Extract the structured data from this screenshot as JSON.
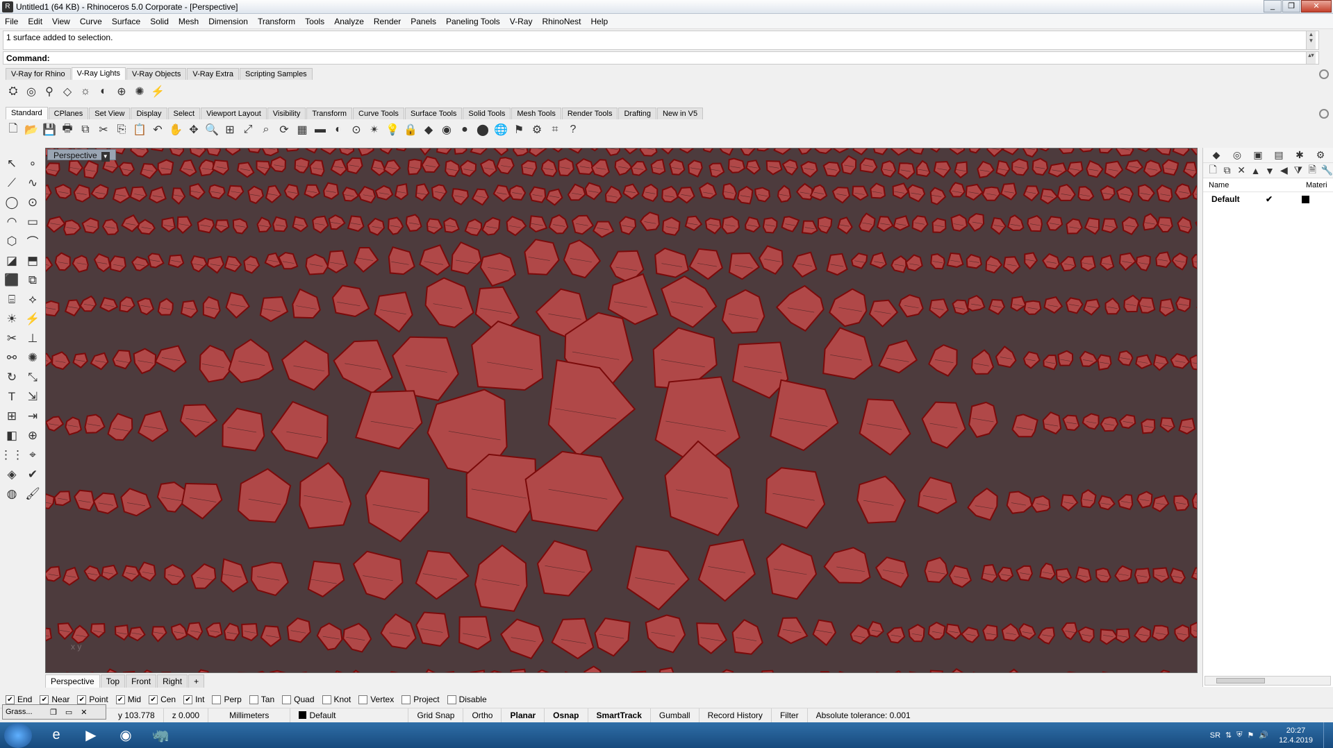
{
  "window": {
    "title": "Untitled1 (64 KB) - Rhinoceros  5.0 Corporate - [Perspective]"
  },
  "menu": [
    "File",
    "Edit",
    "View",
    "Curve",
    "Surface",
    "Solid",
    "Mesh",
    "Dimension",
    "Transform",
    "Tools",
    "Analyze",
    "Render",
    "Panels",
    "Paneling Tools",
    "V-Ray",
    "RhinoNest",
    "Help"
  ],
  "command_history": "1 surface added to selection.",
  "command_prompt": "Command:",
  "vray_tabs": [
    "V-Ray for Rhino",
    "V-Ray Lights",
    "V-Ray Objects",
    "V-Ray Extra",
    "Scripting Samples"
  ],
  "vray_active_tab": "V-Ray Lights",
  "vray_icons": [
    "spot-light-icon",
    "sphere-light-icon",
    "ies-light-icon",
    "rect-light-icon",
    "omni-light-icon",
    "dome-light-icon",
    "sun-icon",
    "sky-light-icon",
    "mesh-light-icon"
  ],
  "main_tabs": [
    "Standard",
    "CPlanes",
    "Set View",
    "Display",
    "Select",
    "Viewport Layout",
    "Visibility",
    "Transform",
    "Curve Tools",
    "Surface Tools",
    "Solid Tools",
    "Mesh Tools",
    "Render Tools",
    "Drafting",
    "New in V5"
  ],
  "main_active_tab": "Standard",
  "standard_icons": [
    {
      "name": "new-icon",
      "glyph": "🗋"
    },
    {
      "name": "open-icon",
      "glyph": "📂"
    },
    {
      "name": "save-icon",
      "glyph": "💾"
    },
    {
      "name": "print-icon",
      "glyph": "🖶"
    },
    {
      "name": "export-icon",
      "glyph": "⧉"
    },
    {
      "name": "cut-icon",
      "glyph": "✂"
    },
    {
      "name": "copy-icon",
      "glyph": "⎘"
    },
    {
      "name": "paste-icon",
      "glyph": "📋"
    },
    {
      "name": "undo-icon",
      "glyph": "↶"
    },
    {
      "name": "pan-icon",
      "glyph": "✋"
    },
    {
      "name": "move-view-icon",
      "glyph": "✥"
    },
    {
      "name": "zoom-icon",
      "glyph": "🔍"
    },
    {
      "name": "zoom-window-icon",
      "glyph": "⊞"
    },
    {
      "name": "zoom-extents-icon",
      "glyph": "⤢"
    },
    {
      "name": "zoom-selected-icon",
      "glyph": "⌕"
    },
    {
      "name": "rotate-view-icon",
      "glyph": "⟳"
    },
    {
      "name": "four-view-icon",
      "glyph": "▦"
    },
    {
      "name": "shaded-icon",
      "glyph": "▬"
    },
    {
      "name": "rendered-icon",
      "glyph": "◐"
    },
    {
      "name": "cplane-icon",
      "glyph": "⊙"
    },
    {
      "name": "point-icon",
      "glyph": "✴"
    },
    {
      "name": "light-icon",
      "glyph": "💡"
    },
    {
      "name": "lock-icon",
      "glyph": "🔒"
    },
    {
      "name": "layer-icon",
      "glyph": "◆"
    },
    {
      "name": "color-icon",
      "glyph": "◉"
    },
    {
      "name": "material-icon",
      "glyph": "●"
    },
    {
      "name": "render-sphere-icon",
      "glyph": "⬤"
    },
    {
      "name": "render-blue-icon",
      "glyph": "🌐"
    },
    {
      "name": "flag-icon",
      "glyph": "⚑"
    },
    {
      "name": "options-icon",
      "glyph": "⚙"
    },
    {
      "name": "grid-icon",
      "glyph": "⌗"
    },
    {
      "name": "help-icon",
      "glyph": "?"
    }
  ],
  "left_tools": [
    {
      "name": "select-icon",
      "glyph": "↖"
    },
    {
      "name": "point-dot-icon",
      "glyph": "∘"
    },
    {
      "name": "polyline-icon",
      "glyph": "⟋"
    },
    {
      "name": "curve-icon",
      "glyph": "∿"
    },
    {
      "name": "circle-icon",
      "glyph": "◯"
    },
    {
      "name": "ellipse-icon",
      "glyph": "⊙"
    },
    {
      "name": "arc-icon",
      "glyph": "◠"
    },
    {
      "name": "rectangle-icon",
      "glyph": "▭"
    },
    {
      "name": "polygon-icon",
      "glyph": "⬡"
    },
    {
      "name": "fillet-icon",
      "glyph": "⌒"
    },
    {
      "name": "surface-corner-icon",
      "glyph": "◪"
    },
    {
      "name": "extrude-icon",
      "glyph": "⬒"
    },
    {
      "name": "box-icon",
      "glyph": "⬛"
    },
    {
      "name": "boolean-icon",
      "glyph": "⧉"
    },
    {
      "name": "cylinder-icon",
      "glyph": "⌸"
    },
    {
      "name": "mesh-icon",
      "glyph": "⟡"
    },
    {
      "name": "light-tool-icon",
      "glyph": "☀"
    },
    {
      "name": "sweep-icon",
      "glyph": "⚡"
    },
    {
      "name": "trim-icon",
      "glyph": "✂"
    },
    {
      "name": "split-icon",
      "glyph": "⊥"
    },
    {
      "name": "join-icon",
      "glyph": "⚯"
    },
    {
      "name": "explode-icon",
      "glyph": "✺"
    },
    {
      "name": "rotate-icon",
      "glyph": "↻"
    },
    {
      "name": "scale-icon",
      "glyph": "⤡"
    },
    {
      "name": "text-icon",
      "glyph": "T"
    },
    {
      "name": "dimension-icon",
      "glyph": "⇲"
    },
    {
      "name": "array-icon",
      "glyph": "⊞"
    },
    {
      "name": "flow-icon",
      "glyph": "⇥"
    },
    {
      "name": "solid-edit-icon",
      "glyph": "◧"
    },
    {
      "name": "unroll-icon",
      "glyph": "⊕"
    },
    {
      "name": "grid-array-icon",
      "glyph": "⋮⋮"
    },
    {
      "name": "gumball-tool-icon",
      "glyph": "⌖"
    },
    {
      "name": "analyze-icon",
      "glyph": "◈"
    },
    {
      "name": "check-icon",
      "glyph": "✔"
    },
    {
      "name": "render-tool-icon",
      "glyph": "◍"
    },
    {
      "name": "paint-icon",
      "glyph": "🖌"
    }
  ],
  "viewport": {
    "label": "Perspective",
    "axes": "x  y"
  },
  "viewport_tabs": [
    "Perspective",
    "Top",
    "Front",
    "Right"
  ],
  "viewport_active_tab": "Perspective",
  "right_panel": {
    "icons": [
      {
        "name": "layers-icon",
        "glyph": "◆"
      },
      {
        "name": "color-wheel-icon",
        "glyph": "◎"
      },
      {
        "name": "display-icon",
        "glyph": "▣"
      },
      {
        "name": "properties-icon",
        "glyph": "▤"
      },
      {
        "name": "render-panel-icon",
        "glyph": "✱"
      },
      {
        "name": "settings-icon",
        "glyph": "⚙"
      }
    ],
    "tool_icons": [
      {
        "name": "new-layer-icon",
        "glyph": "🗋"
      },
      {
        "name": "new-sublayer-icon",
        "glyph": "⧉"
      },
      {
        "name": "delete-layer-icon",
        "glyph": "✕"
      },
      {
        "name": "move-up-icon",
        "glyph": "▲"
      },
      {
        "name": "move-down-icon",
        "glyph": "▼"
      },
      {
        "name": "move-left-icon",
        "glyph": "◀"
      },
      {
        "name": "filter-icon",
        "glyph": "⧩"
      },
      {
        "name": "layer-props-icon",
        "glyph": "🗎"
      },
      {
        "name": "tools-icon",
        "glyph": "🔧"
      }
    ],
    "columns": [
      "Name",
      "Materi"
    ],
    "layers": [
      {
        "name": "Default",
        "current": "✔",
        "color": "#000000"
      }
    ]
  },
  "osnaps": [
    {
      "label": "End",
      "checked": true
    },
    {
      "label": "Near",
      "checked": true
    },
    {
      "label": "Point",
      "checked": true
    },
    {
      "label": "Mid",
      "checked": true
    },
    {
      "label": "Cen",
      "checked": true
    },
    {
      "label": "Int",
      "checked": true
    },
    {
      "label": "Perp",
      "checked": false
    },
    {
      "label": "Tan",
      "checked": false
    },
    {
      "label": "Quad",
      "checked": false
    },
    {
      "label": "Knot",
      "checked": false
    },
    {
      "label": "Vertex",
      "checked": false
    },
    {
      "label": "Project",
      "checked": false
    },
    {
      "label": "Disable",
      "checked": false
    }
  ],
  "status": {
    "y": "y 103.778",
    "z": "z 0.000",
    "units": "Millimeters",
    "layer": "Default",
    "grid_snap": "Grid Snap",
    "ortho": "Ortho",
    "planar": "Planar",
    "osnap": "Osnap",
    "smarttrack": "SmartTrack",
    "gumball": "Gumball",
    "record_history": "Record History",
    "filter": "Filter",
    "tolerance": "Absolute tolerance: 0.001"
  },
  "grasshopper_popup": "Grass...",
  "taskbar": {
    "lang": "SR",
    "time": "20:27",
    "date": "12.4.2019",
    "apps": [
      {
        "name": "ie-icon",
        "glyph": "e"
      },
      {
        "name": "media-player-icon",
        "glyph": "▶"
      },
      {
        "name": "chrome-icon",
        "glyph": "◉"
      },
      {
        "name": "rhino-taskbar-icon",
        "glyph": "🦏"
      }
    ]
  },
  "colors": {
    "cell_fill": "#b04848",
    "cell_edge": "#7a0a0a",
    "viewport_bg": "#4d3b3d"
  }
}
